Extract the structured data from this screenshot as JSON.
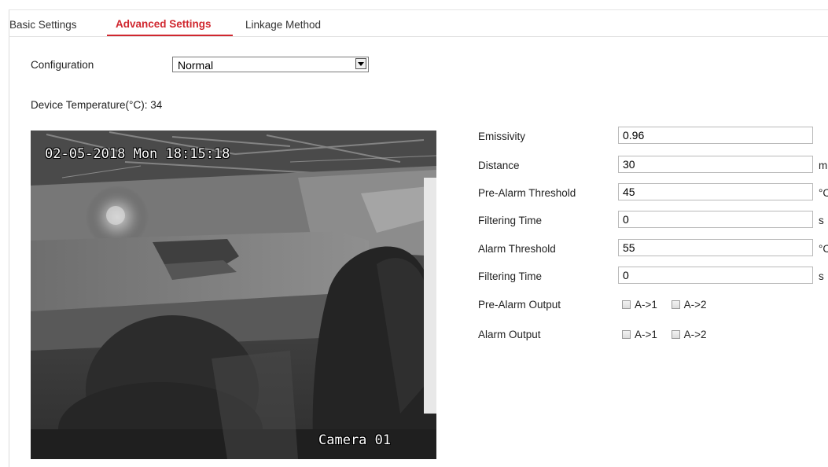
{
  "tabs": [
    {
      "label": "Basic Settings"
    },
    {
      "label": "Advanced Settings",
      "active": true
    },
    {
      "label": "Linkage Method"
    }
  ],
  "configuration": {
    "label": "Configuration",
    "selected": "Normal"
  },
  "device_temperature": "Device Temperature(°C): 34",
  "camera": {
    "timestamp": "02-05-2018 Mon 18:15:18",
    "name": "Camera 01"
  },
  "fields": [
    {
      "label": "Emissivity",
      "value": "0.96",
      "unit": ""
    },
    {
      "label": "Distance",
      "value": "30",
      "unit": "m"
    },
    {
      "label": "Pre-Alarm Threshold",
      "value": "45",
      "unit": "°C"
    },
    {
      "label": "Filtering Time",
      "value": "0",
      "unit": "s"
    },
    {
      "label": "Alarm Threshold",
      "value": "55",
      "unit": "°C"
    },
    {
      "label": "Filtering Time",
      "value": "0",
      "unit": "s"
    }
  ],
  "outputs": [
    {
      "label": "Pre-Alarm Output",
      "options": [
        "A->1",
        "A->2"
      ]
    },
    {
      "label": "Alarm Output",
      "options": [
        "A->1",
        "A->2"
      ]
    }
  ],
  "colors": {
    "accent": "#d0272f"
  }
}
